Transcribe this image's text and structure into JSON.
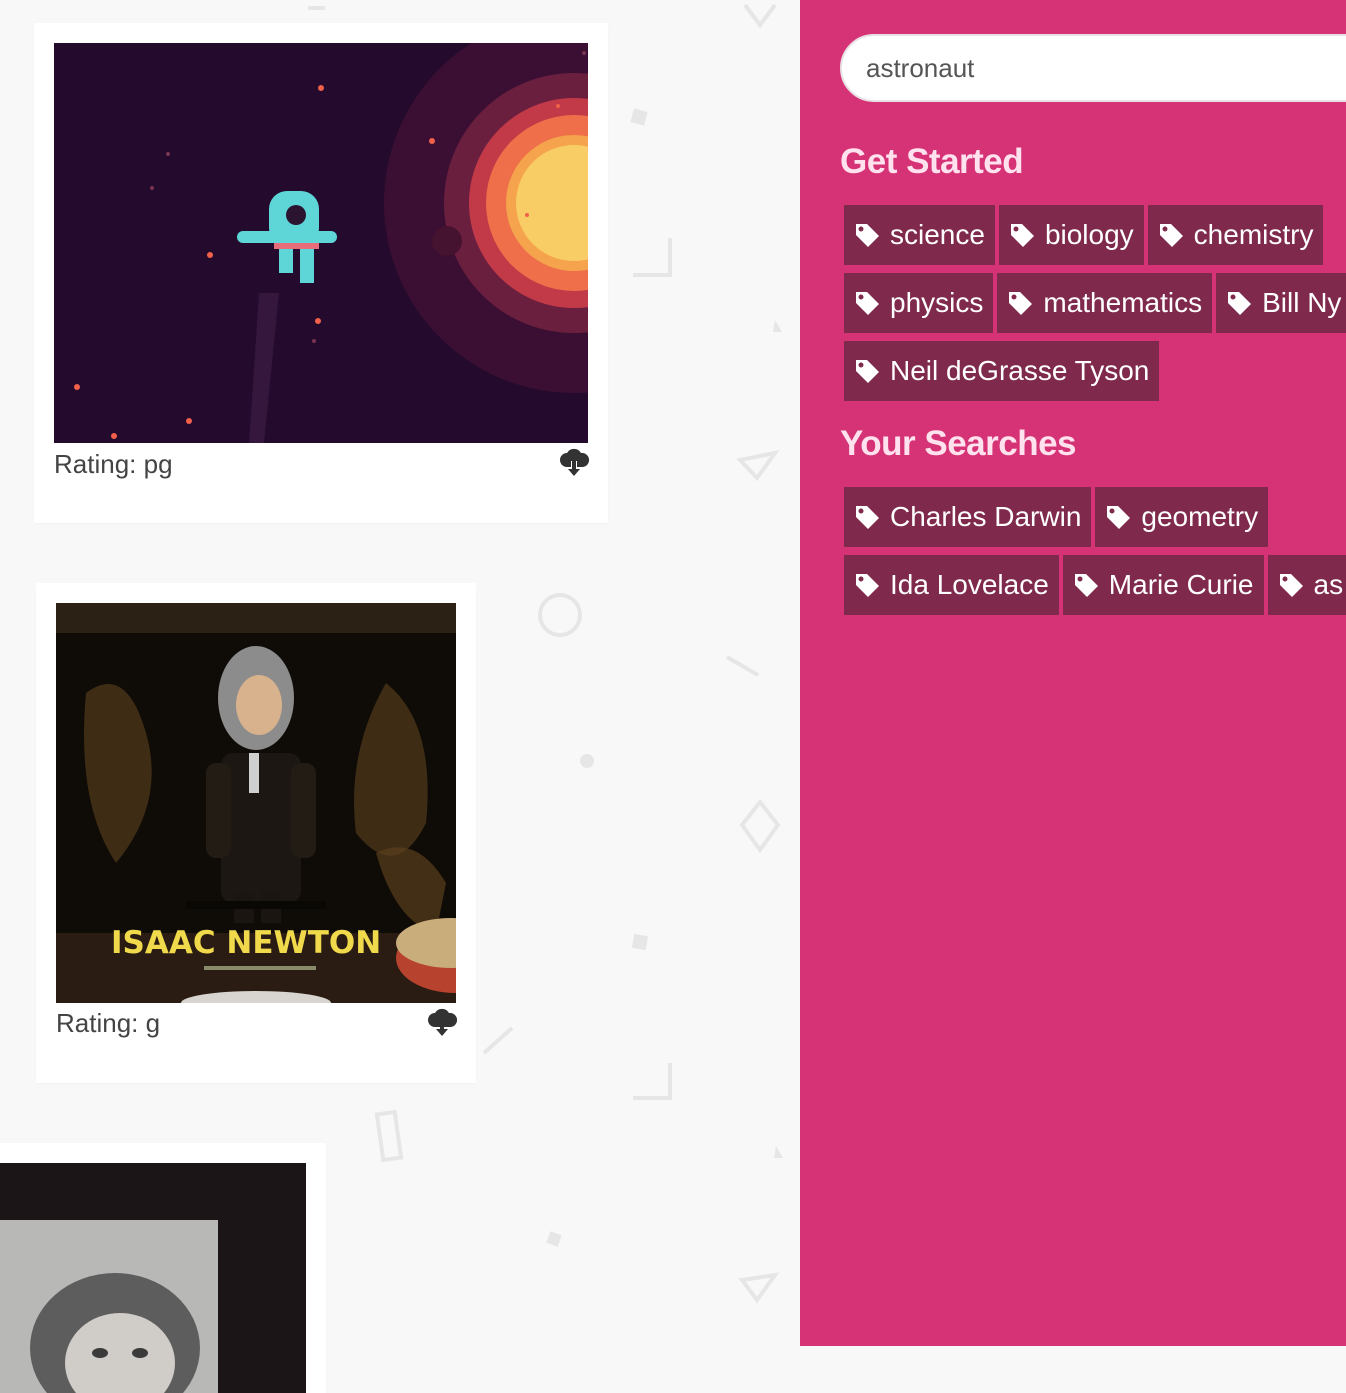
{
  "cards": [
    {
      "rating_label": "Rating: pg",
      "image_alt": "astronaut floating in space near a sun"
    },
    {
      "rating_label": "Rating: g",
      "overlay_text": "ISAAC NEWTON"
    },
    {
      "image_alt": "black and white portrait"
    }
  ],
  "sidebar": {
    "search": {
      "value": "astronaut",
      "placeholder": ""
    },
    "get_started_title": "Get Started",
    "get_started_tags": [
      "science",
      "biology",
      "chemistry",
      "physics",
      "mathematics",
      "Bill Ny",
      "Neil deGrasse Tyson"
    ],
    "your_searches_title": "Your Searches",
    "your_searches_tags": [
      "Charles Darwin",
      "geometry",
      "Ida Lovelace",
      "Marie Curie",
      "as"
    ]
  },
  "icons": {
    "tag": "tag-icon",
    "download": "cloud-download-icon"
  },
  "colors": {
    "panel_bg": "#d63377",
    "tag_bg": "#7f2a4c",
    "heading": "#ffe2ee"
  }
}
